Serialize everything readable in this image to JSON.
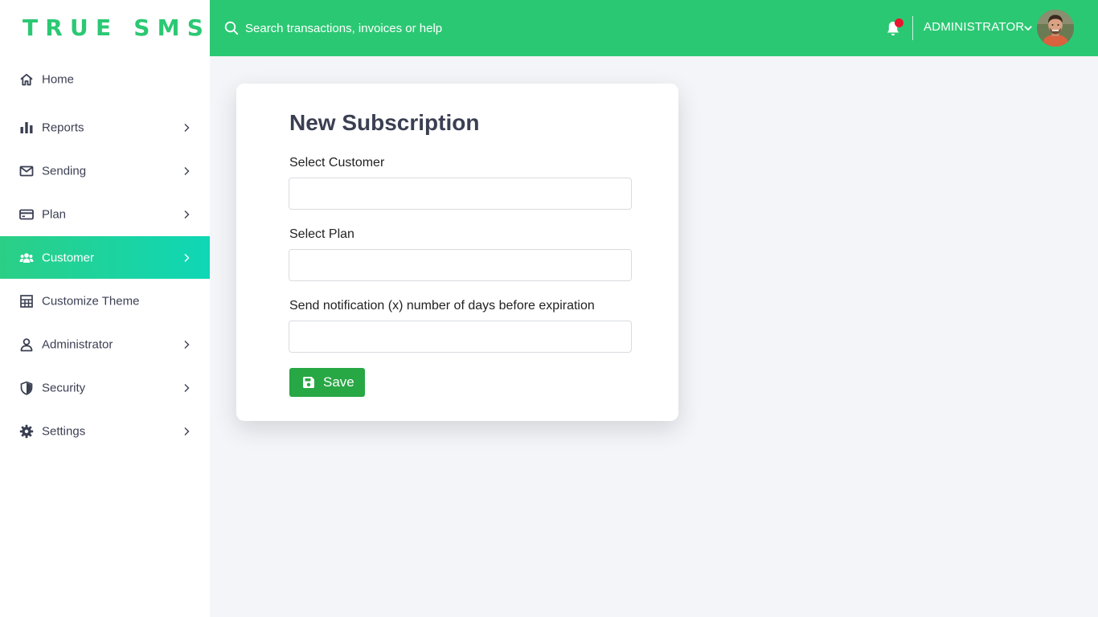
{
  "brand": {
    "logo_text": "TRUE SMS",
    "primary_color": "#2bc873",
    "active_gradient": [
      "#2bcf86",
      "#0fd7b6"
    ]
  },
  "header": {
    "search_placeholder": "Search transactions, invoices or help",
    "user_name": "ADMINISTRATOR",
    "notification_indicator_color": "#e8152e"
  },
  "sidebar": {
    "items": [
      {
        "label": "Home",
        "icon": "home-icon",
        "has_submenu": false,
        "active": false
      },
      {
        "label": "Reports",
        "icon": "bar-chart-icon",
        "has_submenu": true,
        "active": false
      },
      {
        "label": "Sending",
        "icon": "envelope-icon",
        "has_submenu": true,
        "active": false
      },
      {
        "label": "Plan",
        "icon": "credit-card-icon",
        "has_submenu": true,
        "active": false
      },
      {
        "label": "Customer",
        "icon": "users-icon",
        "has_submenu": true,
        "active": true
      },
      {
        "label": "Customize Theme",
        "icon": "layout-grid-icon",
        "has_submenu": false,
        "active": false
      },
      {
        "label": "Administrator",
        "icon": "user-icon",
        "has_submenu": true,
        "active": false
      },
      {
        "label": "Security",
        "icon": "shield-icon",
        "has_submenu": true,
        "active": false
      },
      {
        "label": "Settings",
        "icon": "gear-icon",
        "has_submenu": true,
        "active": false
      }
    ]
  },
  "form": {
    "title": "New Subscription",
    "fields": [
      {
        "label": "Select Customer",
        "value": ""
      },
      {
        "label": "Select Plan",
        "value": ""
      },
      {
        "label": "Send notification (x) number of days before expiration",
        "value": ""
      }
    ],
    "save_label": "Save",
    "save_color": "#28a745"
  }
}
